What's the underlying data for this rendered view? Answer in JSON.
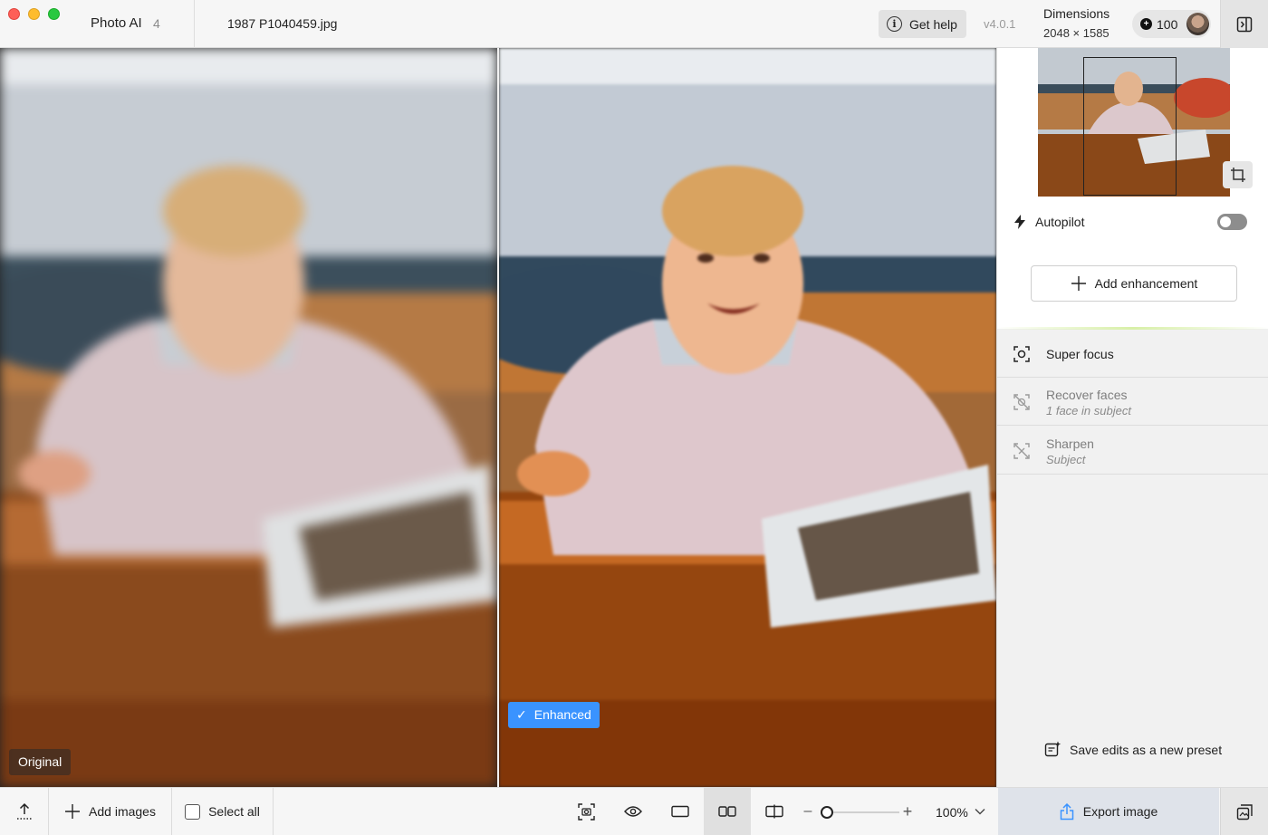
{
  "titlebar": {
    "app_name": "Photo AI",
    "app_version_badge": "4",
    "file_name": "1987 P1040459.jpg",
    "help_label": "Get help",
    "version": "v4.0.1",
    "dimensions_title": "Dimensions",
    "dimensions_value": "2048 × 1585",
    "credits": "100"
  },
  "canvas": {
    "original_label": "Original",
    "enhanced_label": "Enhanced",
    "enhanced_check": "✓"
  },
  "side": {
    "autopilot_label": "Autopilot",
    "autopilot_on": false,
    "add_enhancement_label": "Add enhancement",
    "enhancements": [
      {
        "label": "Super focus",
        "sub": "",
        "active": true,
        "icon": "super-focus-icon"
      },
      {
        "label": "Recover faces",
        "sub": "1 face in subject",
        "active": false,
        "icon": "recover-faces-icon"
      },
      {
        "label": "Sharpen",
        "sub": "Subject",
        "active": false,
        "icon": "sharpen-icon"
      }
    ],
    "save_preset_label": "Save edits as a new preset"
  },
  "bottombar": {
    "add_images_label": "Add images",
    "select_all_label": "Select all",
    "zoom_value": "100%",
    "export_label": "Export image"
  },
  "colors": {
    "accent": "#3a93ff",
    "toggle_off": "#8d8d8d",
    "export_bg": "#dfe3ea"
  }
}
